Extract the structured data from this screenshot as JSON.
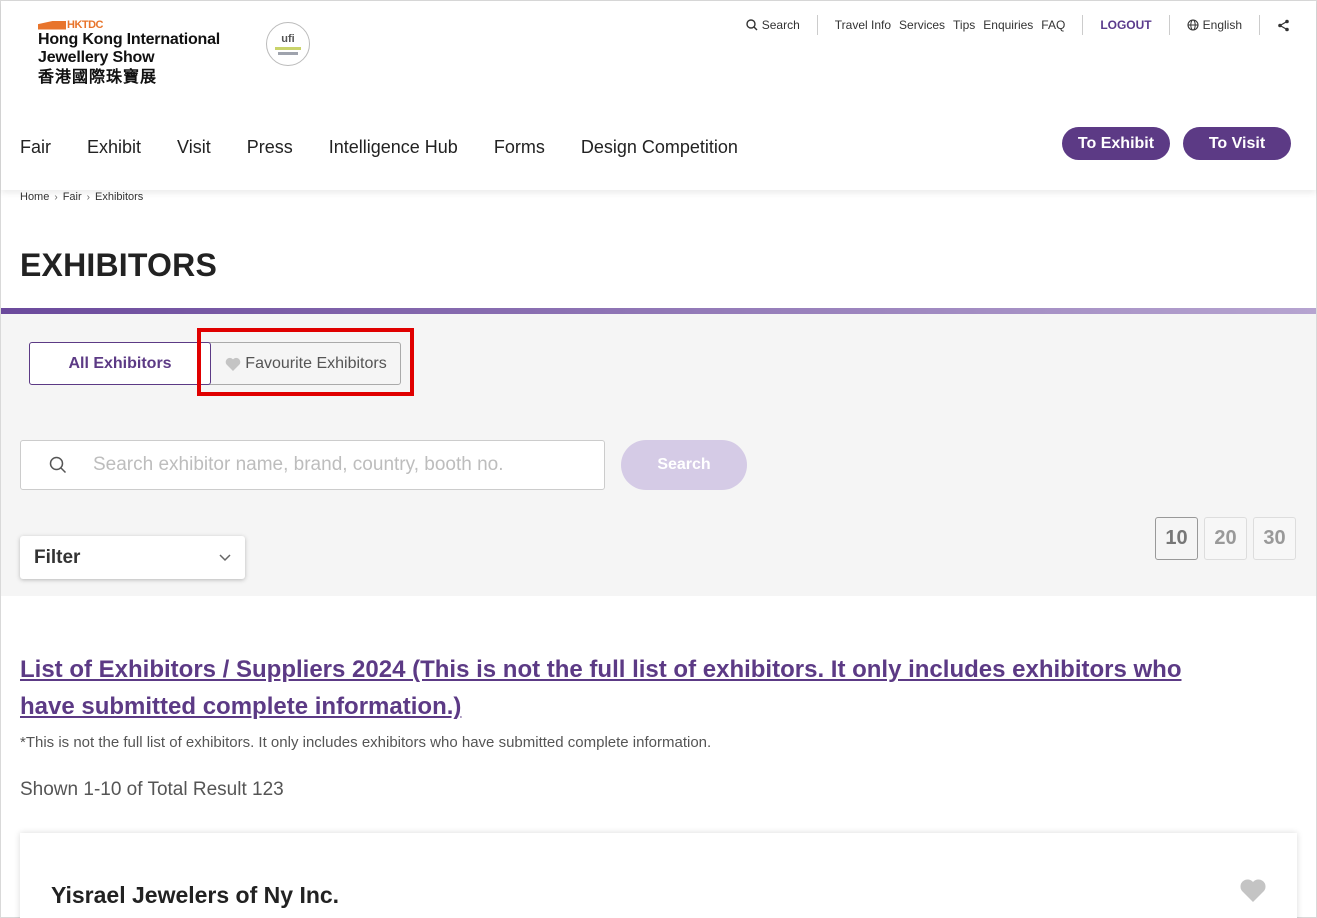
{
  "logo": {
    "brand": "HKTDC",
    "line1": "Hong Kong International",
    "line2": "Jewellery Show",
    "chinese": "香港國際珠寶展",
    "badge": "ufi"
  },
  "utility_nav": {
    "search": "Search",
    "links": [
      "Travel Info",
      "Services",
      "Tips",
      "Enquiries",
      "FAQ"
    ],
    "logout": "LOGOUT",
    "language": "English"
  },
  "main_nav": {
    "items": [
      "Fair",
      "Exhibit",
      "Visit",
      "Press",
      "Intelligence Hub",
      "Forms",
      "Design Competition"
    ],
    "to_exhibit": "To Exhibit",
    "to_visit": "To Visit"
  },
  "breadcrumb": [
    "Home",
    "Fair",
    "Exhibitors"
  ],
  "page_title": "EXHIBITORS",
  "tabs": {
    "all": "All Exhibitors",
    "favourite": "Favourite Exhibitors"
  },
  "search": {
    "placeholder": "Search exhibitor name, brand, country, booth no.",
    "value": "",
    "button": "Search"
  },
  "filter": {
    "label": "Filter"
  },
  "page_size": {
    "options": [
      "10",
      "20",
      "30"
    ],
    "selected": "10"
  },
  "list": {
    "title": "List of Exhibitors / Suppliers 2024 (This is not the full list of exhibitors. It only includes exhibitors who have submitted complete information.)",
    "note": "*This is not the full list of exhibitors. It only includes exhibitors who have submitted complete information.",
    "result_summary": "Shown 1-10 of Total Result 123",
    "items": [
      {
        "name": "Yisrael Jewelers of Ny Inc."
      }
    ]
  },
  "colors": {
    "brand_purple": "#5c3a85",
    "accent_orange": "#e8742b",
    "highlight_red": "#e00000",
    "search_button_disabled": "#d5cbe6"
  }
}
